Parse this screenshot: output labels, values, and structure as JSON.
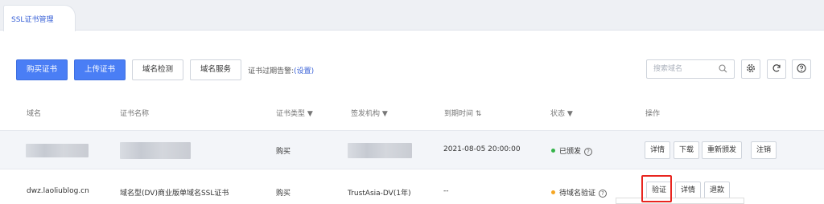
{
  "tab": {
    "label": "SSL证书管理"
  },
  "toolbar": {
    "buy": "购买证书",
    "upload": "上传证书",
    "domain_check": "域名检测",
    "domain_service": "域名服务",
    "expiry_note": "证书过期告警:",
    "expiry_link": "(设置)"
  },
  "search": {
    "placeholder": "搜索域名"
  },
  "icons": {
    "search": "search-icon",
    "settings": "gear-icon",
    "refresh": "refresh-icon",
    "help": "help-icon"
  },
  "columns": {
    "domain": "域名",
    "cert_name": "证书名称",
    "cert_type": "证书类型",
    "issuer": "签发机构",
    "expiry": "到期时间",
    "status": "状态",
    "actions": "操作"
  },
  "rows": [
    {
      "cert_type": "购买",
      "expiry": "2021-08-05 20:00:00",
      "status": "已颁发",
      "status_color": "#35b34a",
      "actions": [
        "详情",
        "下载",
        "重新颁发",
        "注销"
      ]
    },
    {
      "domain": "dwz.laoliublog.cn",
      "cert_name": "域名型(DV)商业版单域名SSL证书",
      "cert_type": "购买",
      "issuer": "TrustAsia-DV(1年)",
      "expiry": "--",
      "status": "待域名验证",
      "status_color": "#f5a623",
      "actions": [
        "验证",
        "详情",
        "退款"
      ]
    }
  ],
  "colors": {
    "primary": "#4a7ef5",
    "highlight": "#e8251f"
  }
}
